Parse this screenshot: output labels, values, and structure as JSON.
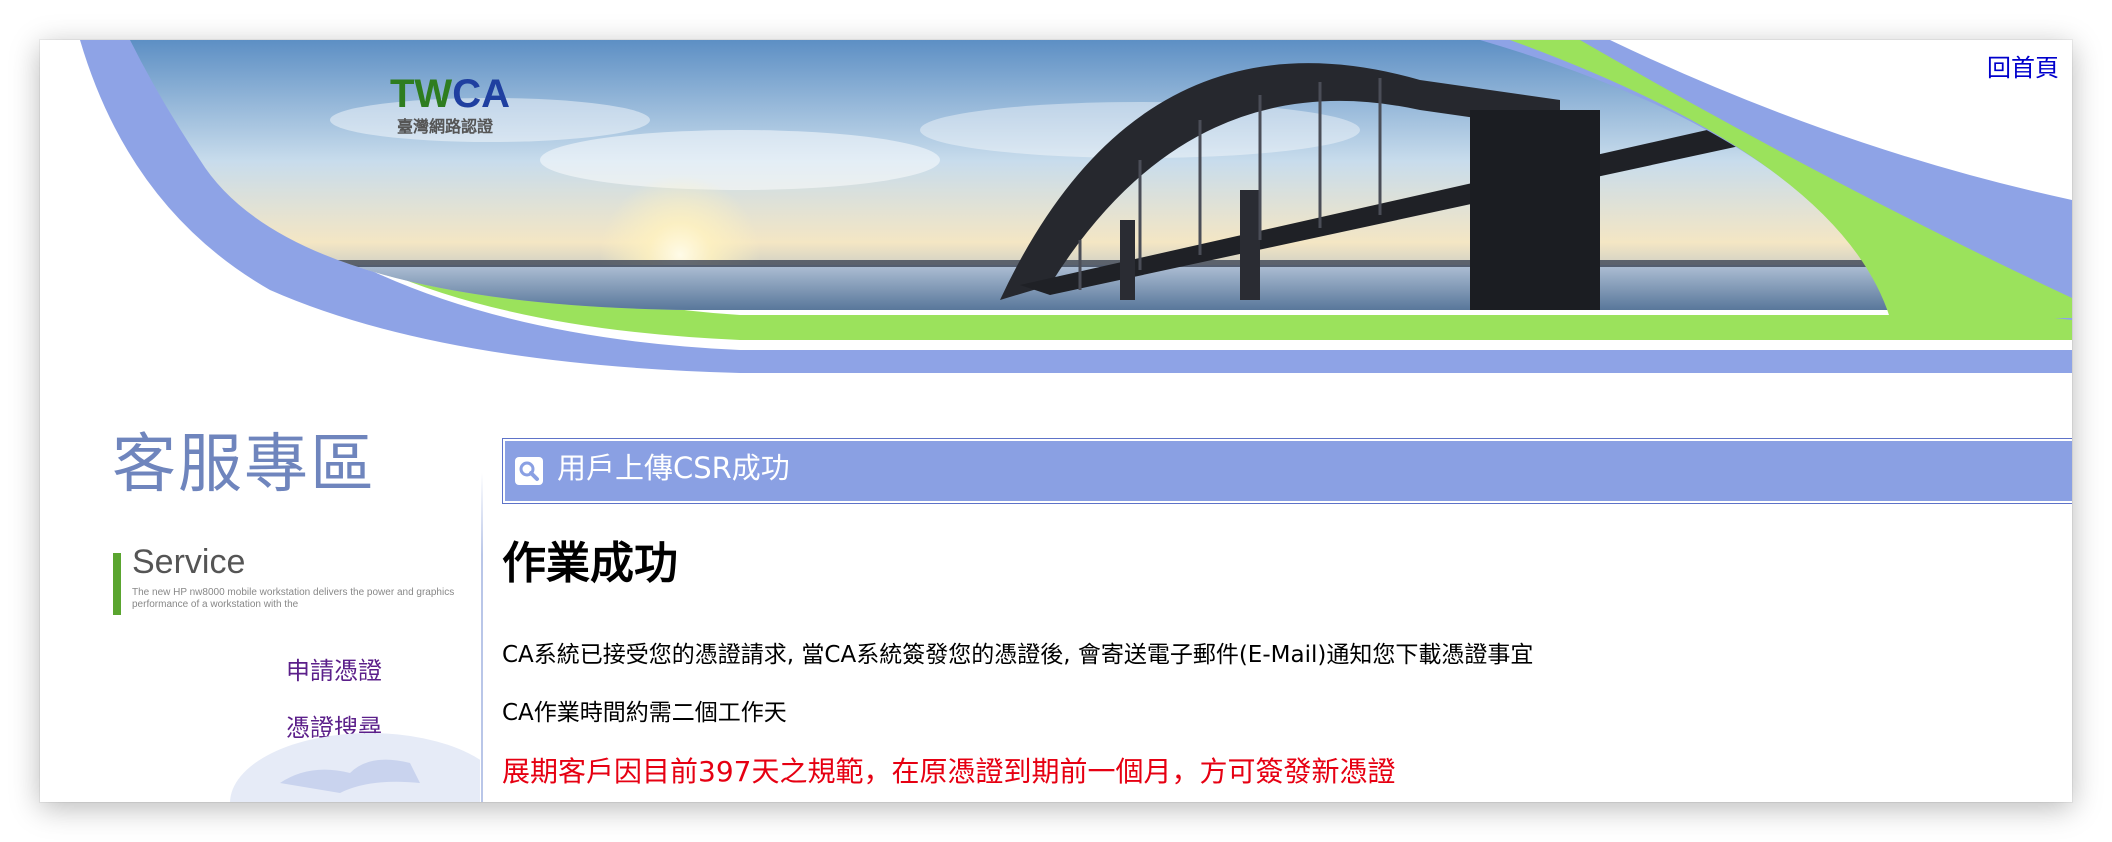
{
  "header": {
    "home_link": "回首頁",
    "logo_text": "TWCA",
    "logo_subtitle": "臺灣網路認證"
  },
  "sidebar": {
    "title": "客服專區",
    "service_word": "Service",
    "service_desc": "The new HP nw8000 mobile workstation delivers the power and graphics performance of a workstation with the",
    "links": [
      {
        "label": "申請憑證"
      },
      {
        "label": "憑證搜尋"
      }
    ]
  },
  "main": {
    "heading": "用戶上傳CSR成功",
    "title": "作業成功",
    "paragraph1": "CA系統已接受您的憑證請求, 當CA系統簽發您的憑證後, 會寄送電子郵件(E-Mail)通知您下載憑證事宜",
    "paragraph2": "CA作業時間約需二個工作天",
    "notice": "展期客戶因目前397天之規範，在原憑證到期前一個月，方可簽發新憑證"
  },
  "colors": {
    "heading_bar": "#8aa0e3",
    "banner_blue": "#8ea3e6",
    "banner_green": "#9be25c",
    "sidebar_link": "#5b1f8a",
    "notice_red": "#e60012",
    "home_link": "#0000cc"
  }
}
